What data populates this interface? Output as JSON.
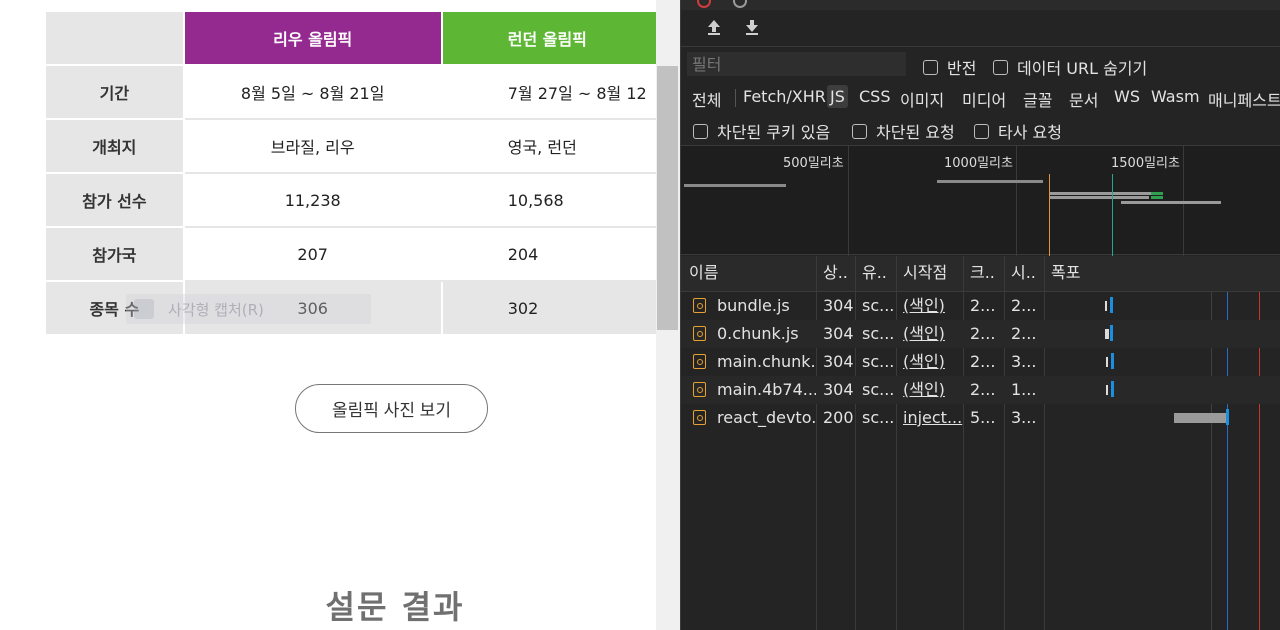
{
  "page": {
    "table": {
      "columns": [
        {
          "label": "리우 올림픽",
          "color": "#942990"
        },
        {
          "label": "런던 올림픽",
          "color": "#5db634"
        }
      ],
      "rows": [
        {
          "label": "기간",
          "rio": "8월 5일 ~ 8월 21일",
          "london": "7월 27일 ~ 8월 12"
        },
        {
          "label": "개최지",
          "rio": "브라질, 리우",
          "london": "영국, 런던"
        },
        {
          "label": "참가 선수",
          "rio": "11,238",
          "london": "10,568"
        },
        {
          "label": "참가국",
          "rio": "207",
          "london": "204"
        },
        {
          "label": "종목 수",
          "rio": "306",
          "london": "302"
        }
      ]
    },
    "ghost_overlay_text": "사각형 캡처(R)",
    "photos_button": "올림픽 사진 보기",
    "section_title": "설문 결과"
  },
  "devtools": {
    "filter": {
      "placeholder": "필터",
      "invert_label": "반전",
      "hide_data_urls_label": "데이터 URL 숨기기"
    },
    "types": [
      "전체",
      "Fetch/XHR",
      "JS",
      "CSS",
      "이미지",
      "미디어",
      "글꼴",
      "문서",
      "WS",
      "Wasm",
      "매니페스트"
    ],
    "active_type": "JS",
    "blocked": {
      "blocked_cookies": "차단된 쿠키 있음",
      "blocked_requests": "차단된 요청",
      "third_party": "타사 요청"
    },
    "overview_ticks": [
      "500밀리초",
      "1000밀리초",
      "1500밀리초"
    ],
    "columns": [
      "이름",
      "상..",
      "유..",
      "시작점",
      "크..",
      "시..",
      "폭포"
    ],
    "requests": [
      {
        "name": "bundle.js",
        "status": "304",
        "type": "sc...",
        "initiator": "(색인)",
        "size": "2...",
        "time": "2..."
      },
      {
        "name": "0.chunk.js",
        "status": "304",
        "type": "sc...",
        "initiator": "(색인)",
        "size": "2...",
        "time": "2..."
      },
      {
        "name": "main.chunk...",
        "status": "304",
        "type": "sc...",
        "initiator": "(색인)",
        "size": "2...",
        "time": "3..."
      },
      {
        "name": "main.4b74...",
        "status": "304",
        "type": "sc...",
        "initiator": "(색인)",
        "size": "2...",
        "time": "1..."
      },
      {
        "name": "react_devto...",
        "status": "200",
        "type": "sc...",
        "initiator": "inject...",
        "size": "5...",
        "time": "3..."
      }
    ],
    "colors": {
      "panel_bg": "#242424",
      "accent_blue": "#1a8fe0",
      "dom_loaded_line": "#2d6cc4",
      "load_line": "#c0392b",
      "overview_orange": "#e88d3c",
      "overview_teal": "#26a69a"
    }
  }
}
